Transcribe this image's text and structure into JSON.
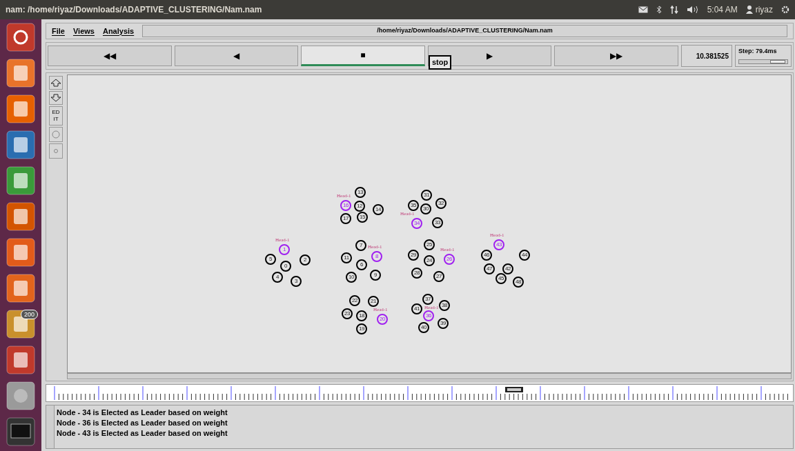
{
  "window": {
    "title": "nam: /home/riyaz/Downloads/ADAPTIVE_CLUSTERING/Nam.nam"
  },
  "tray": {
    "time": "5:04 AM",
    "user": "riyaz"
  },
  "launcher": {
    "badge": "200"
  },
  "menu": [
    {
      "label": "File"
    },
    {
      "label": "Views"
    },
    {
      "label": "Analysis"
    }
  ],
  "path": "/home/riyaz/Downloads/ADAPTIVE_CLUSTERING/Nam.nam",
  "controls": [
    {
      "glyph": "◀◀",
      "selected": false
    },
    {
      "glyph": "◀",
      "selected": false
    },
    {
      "glyph": "■",
      "selected": true
    },
    {
      "glyph": "▶",
      "selected": false
    },
    {
      "glyph": "▶▶",
      "selected": false
    }
  ],
  "tooltip": "stop",
  "time": "10.381525",
  "step": {
    "label": "Step: 79.4ms",
    "level": 0.8
  },
  "toolbar": {
    "edit": "ED IT"
  },
  "nodes": [
    {
      "id": "13",
      "head": false
    },
    {
      "id": "31",
      "head": false
    },
    {
      "id": "16",
      "head": true,
      "label": "Head-1"
    },
    {
      "id": "12",
      "head": false
    },
    {
      "id": "14",
      "head": false
    },
    {
      "id": "35",
      "head": false
    },
    {
      "id": "30",
      "head": false
    },
    {
      "id": "32",
      "head": false
    },
    {
      "id": "17",
      "head": false
    },
    {
      "id": "15",
      "head": false
    },
    {
      "id": "34",
      "head": true,
      "label": "Head-1"
    },
    {
      "id": "33",
      "head": false
    },
    {
      "id": "1",
      "head": true,
      "label": "Head-1"
    },
    {
      "id": "7",
      "head": false
    },
    {
      "id": "25",
      "head": false
    },
    {
      "id": "43",
      "head": true,
      "label": "Head-1"
    },
    {
      "id": "5",
      "head": false
    },
    {
      "id": "2",
      "head": false
    },
    {
      "id": "11",
      "head": false
    },
    {
      "id": "8",
      "head": true,
      "label": "Head-1"
    },
    {
      "id": "29",
      "head": false
    },
    {
      "id": "24",
      "head": false
    },
    {
      "id": "26",
      "head": true,
      "label": "Head-1"
    },
    {
      "id": "46",
      "head": false
    },
    {
      "id": "44",
      "head": false
    },
    {
      "id": "0",
      "head": false
    },
    {
      "id": "6",
      "head": false
    },
    {
      "id": "47",
      "head": false
    },
    {
      "id": "42",
      "head": false
    },
    {
      "id": "4",
      "head": false
    },
    {
      "id": "3",
      "head": false
    },
    {
      "id": "10",
      "head": false
    },
    {
      "id": "9",
      "head": false
    },
    {
      "id": "28",
      "head": false
    },
    {
      "id": "27",
      "head": false
    },
    {
      "id": "45",
      "head": false
    },
    {
      "id": "48",
      "head": false
    },
    {
      "id": "22",
      "head": false
    },
    {
      "id": "21",
      "head": false
    },
    {
      "id": "37",
      "head": false
    },
    {
      "id": "41",
      "head": false
    },
    {
      "id": "38",
      "head": false
    },
    {
      "id": "23",
      "head": false
    },
    {
      "id": "18",
      "head": false
    },
    {
      "id": "20",
      "head": true,
      "label": "Head-1"
    },
    {
      "id": "36",
      "head": true,
      "label": "Head-1"
    },
    {
      "id": "19",
      "head": false
    },
    {
      "id": "40",
      "head": false
    },
    {
      "id": "39",
      "head": false
    }
  ],
  "log": [
    "Node - 34 is Elected as Leader based on weight",
    "Node - 36 is Elected as Leader based on weight",
    "Node - 43 is Elected as Leader based on weight"
  ]
}
